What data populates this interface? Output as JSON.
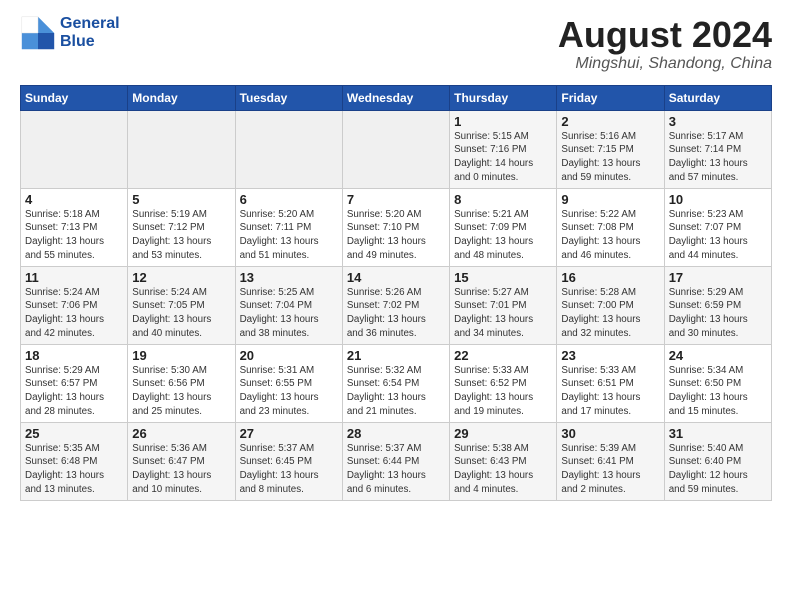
{
  "logo": {
    "line1": "General",
    "line2": "Blue"
  },
  "title": {
    "month_year": "August 2024",
    "location": "Mingshui, Shandong, China"
  },
  "days_of_week": [
    "Sunday",
    "Monday",
    "Tuesday",
    "Wednesday",
    "Thursday",
    "Friday",
    "Saturday"
  ],
  "weeks": [
    [
      {
        "day": "",
        "info": ""
      },
      {
        "day": "",
        "info": ""
      },
      {
        "day": "",
        "info": ""
      },
      {
        "day": "",
        "info": ""
      },
      {
        "day": "1",
        "info": "Sunrise: 5:15 AM\nSunset: 7:16 PM\nDaylight: 14 hours\nand 0 minutes."
      },
      {
        "day": "2",
        "info": "Sunrise: 5:16 AM\nSunset: 7:15 PM\nDaylight: 13 hours\nand 59 minutes."
      },
      {
        "day": "3",
        "info": "Sunrise: 5:17 AM\nSunset: 7:14 PM\nDaylight: 13 hours\nand 57 minutes."
      }
    ],
    [
      {
        "day": "4",
        "info": "Sunrise: 5:18 AM\nSunset: 7:13 PM\nDaylight: 13 hours\nand 55 minutes."
      },
      {
        "day": "5",
        "info": "Sunrise: 5:19 AM\nSunset: 7:12 PM\nDaylight: 13 hours\nand 53 minutes."
      },
      {
        "day": "6",
        "info": "Sunrise: 5:20 AM\nSunset: 7:11 PM\nDaylight: 13 hours\nand 51 minutes."
      },
      {
        "day": "7",
        "info": "Sunrise: 5:20 AM\nSunset: 7:10 PM\nDaylight: 13 hours\nand 49 minutes."
      },
      {
        "day": "8",
        "info": "Sunrise: 5:21 AM\nSunset: 7:09 PM\nDaylight: 13 hours\nand 48 minutes."
      },
      {
        "day": "9",
        "info": "Sunrise: 5:22 AM\nSunset: 7:08 PM\nDaylight: 13 hours\nand 46 minutes."
      },
      {
        "day": "10",
        "info": "Sunrise: 5:23 AM\nSunset: 7:07 PM\nDaylight: 13 hours\nand 44 minutes."
      }
    ],
    [
      {
        "day": "11",
        "info": "Sunrise: 5:24 AM\nSunset: 7:06 PM\nDaylight: 13 hours\nand 42 minutes."
      },
      {
        "day": "12",
        "info": "Sunrise: 5:24 AM\nSunset: 7:05 PM\nDaylight: 13 hours\nand 40 minutes."
      },
      {
        "day": "13",
        "info": "Sunrise: 5:25 AM\nSunset: 7:04 PM\nDaylight: 13 hours\nand 38 minutes."
      },
      {
        "day": "14",
        "info": "Sunrise: 5:26 AM\nSunset: 7:02 PM\nDaylight: 13 hours\nand 36 minutes."
      },
      {
        "day": "15",
        "info": "Sunrise: 5:27 AM\nSunset: 7:01 PM\nDaylight: 13 hours\nand 34 minutes."
      },
      {
        "day": "16",
        "info": "Sunrise: 5:28 AM\nSunset: 7:00 PM\nDaylight: 13 hours\nand 32 minutes."
      },
      {
        "day": "17",
        "info": "Sunrise: 5:29 AM\nSunset: 6:59 PM\nDaylight: 13 hours\nand 30 minutes."
      }
    ],
    [
      {
        "day": "18",
        "info": "Sunrise: 5:29 AM\nSunset: 6:57 PM\nDaylight: 13 hours\nand 28 minutes."
      },
      {
        "day": "19",
        "info": "Sunrise: 5:30 AM\nSunset: 6:56 PM\nDaylight: 13 hours\nand 25 minutes."
      },
      {
        "day": "20",
        "info": "Sunrise: 5:31 AM\nSunset: 6:55 PM\nDaylight: 13 hours\nand 23 minutes."
      },
      {
        "day": "21",
        "info": "Sunrise: 5:32 AM\nSunset: 6:54 PM\nDaylight: 13 hours\nand 21 minutes."
      },
      {
        "day": "22",
        "info": "Sunrise: 5:33 AM\nSunset: 6:52 PM\nDaylight: 13 hours\nand 19 minutes."
      },
      {
        "day": "23",
        "info": "Sunrise: 5:33 AM\nSunset: 6:51 PM\nDaylight: 13 hours\nand 17 minutes."
      },
      {
        "day": "24",
        "info": "Sunrise: 5:34 AM\nSunset: 6:50 PM\nDaylight: 13 hours\nand 15 minutes."
      }
    ],
    [
      {
        "day": "25",
        "info": "Sunrise: 5:35 AM\nSunset: 6:48 PM\nDaylight: 13 hours\nand 13 minutes."
      },
      {
        "day": "26",
        "info": "Sunrise: 5:36 AM\nSunset: 6:47 PM\nDaylight: 13 hours\nand 10 minutes."
      },
      {
        "day": "27",
        "info": "Sunrise: 5:37 AM\nSunset: 6:45 PM\nDaylight: 13 hours\nand 8 minutes."
      },
      {
        "day": "28",
        "info": "Sunrise: 5:37 AM\nSunset: 6:44 PM\nDaylight: 13 hours\nand 6 minutes."
      },
      {
        "day": "29",
        "info": "Sunrise: 5:38 AM\nSunset: 6:43 PM\nDaylight: 13 hours\nand 4 minutes."
      },
      {
        "day": "30",
        "info": "Sunrise: 5:39 AM\nSunset: 6:41 PM\nDaylight: 13 hours\nand 2 minutes."
      },
      {
        "day": "31",
        "info": "Sunrise: 5:40 AM\nSunset: 6:40 PM\nDaylight: 12 hours\nand 59 minutes."
      }
    ]
  ]
}
